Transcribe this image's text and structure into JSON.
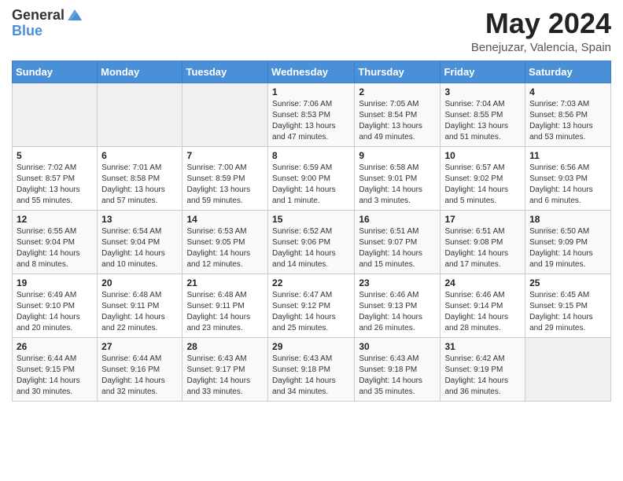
{
  "header": {
    "logo_general": "General",
    "logo_blue": "Blue",
    "title": "May 2024",
    "location": "Benejuzar, Valencia, Spain"
  },
  "days_of_week": [
    "Sunday",
    "Monday",
    "Tuesday",
    "Wednesday",
    "Thursday",
    "Friday",
    "Saturday"
  ],
  "weeks": [
    [
      {
        "day": "",
        "info": ""
      },
      {
        "day": "",
        "info": ""
      },
      {
        "day": "",
        "info": ""
      },
      {
        "day": "1",
        "info": "Sunrise: 7:06 AM\nSunset: 8:53 PM\nDaylight: 13 hours\nand 47 minutes."
      },
      {
        "day": "2",
        "info": "Sunrise: 7:05 AM\nSunset: 8:54 PM\nDaylight: 13 hours\nand 49 minutes."
      },
      {
        "day": "3",
        "info": "Sunrise: 7:04 AM\nSunset: 8:55 PM\nDaylight: 13 hours\nand 51 minutes."
      },
      {
        "day": "4",
        "info": "Sunrise: 7:03 AM\nSunset: 8:56 PM\nDaylight: 13 hours\nand 53 minutes."
      }
    ],
    [
      {
        "day": "5",
        "info": "Sunrise: 7:02 AM\nSunset: 8:57 PM\nDaylight: 13 hours\nand 55 minutes."
      },
      {
        "day": "6",
        "info": "Sunrise: 7:01 AM\nSunset: 8:58 PM\nDaylight: 13 hours\nand 57 minutes."
      },
      {
        "day": "7",
        "info": "Sunrise: 7:00 AM\nSunset: 8:59 PM\nDaylight: 13 hours\nand 59 minutes."
      },
      {
        "day": "8",
        "info": "Sunrise: 6:59 AM\nSunset: 9:00 PM\nDaylight: 14 hours\nand 1 minute."
      },
      {
        "day": "9",
        "info": "Sunrise: 6:58 AM\nSunset: 9:01 PM\nDaylight: 14 hours\nand 3 minutes."
      },
      {
        "day": "10",
        "info": "Sunrise: 6:57 AM\nSunset: 9:02 PM\nDaylight: 14 hours\nand 5 minutes."
      },
      {
        "day": "11",
        "info": "Sunrise: 6:56 AM\nSunset: 9:03 PM\nDaylight: 14 hours\nand 6 minutes."
      }
    ],
    [
      {
        "day": "12",
        "info": "Sunrise: 6:55 AM\nSunset: 9:04 PM\nDaylight: 14 hours\nand 8 minutes."
      },
      {
        "day": "13",
        "info": "Sunrise: 6:54 AM\nSunset: 9:04 PM\nDaylight: 14 hours\nand 10 minutes."
      },
      {
        "day": "14",
        "info": "Sunrise: 6:53 AM\nSunset: 9:05 PM\nDaylight: 14 hours\nand 12 minutes."
      },
      {
        "day": "15",
        "info": "Sunrise: 6:52 AM\nSunset: 9:06 PM\nDaylight: 14 hours\nand 14 minutes."
      },
      {
        "day": "16",
        "info": "Sunrise: 6:51 AM\nSunset: 9:07 PM\nDaylight: 14 hours\nand 15 minutes."
      },
      {
        "day": "17",
        "info": "Sunrise: 6:51 AM\nSunset: 9:08 PM\nDaylight: 14 hours\nand 17 minutes."
      },
      {
        "day": "18",
        "info": "Sunrise: 6:50 AM\nSunset: 9:09 PM\nDaylight: 14 hours\nand 19 minutes."
      }
    ],
    [
      {
        "day": "19",
        "info": "Sunrise: 6:49 AM\nSunset: 9:10 PM\nDaylight: 14 hours\nand 20 minutes."
      },
      {
        "day": "20",
        "info": "Sunrise: 6:48 AM\nSunset: 9:11 PM\nDaylight: 14 hours\nand 22 minutes."
      },
      {
        "day": "21",
        "info": "Sunrise: 6:48 AM\nSunset: 9:11 PM\nDaylight: 14 hours\nand 23 minutes."
      },
      {
        "day": "22",
        "info": "Sunrise: 6:47 AM\nSunset: 9:12 PM\nDaylight: 14 hours\nand 25 minutes."
      },
      {
        "day": "23",
        "info": "Sunrise: 6:46 AM\nSunset: 9:13 PM\nDaylight: 14 hours\nand 26 minutes."
      },
      {
        "day": "24",
        "info": "Sunrise: 6:46 AM\nSunset: 9:14 PM\nDaylight: 14 hours\nand 28 minutes."
      },
      {
        "day": "25",
        "info": "Sunrise: 6:45 AM\nSunset: 9:15 PM\nDaylight: 14 hours\nand 29 minutes."
      }
    ],
    [
      {
        "day": "26",
        "info": "Sunrise: 6:44 AM\nSunset: 9:15 PM\nDaylight: 14 hours\nand 30 minutes."
      },
      {
        "day": "27",
        "info": "Sunrise: 6:44 AM\nSunset: 9:16 PM\nDaylight: 14 hours\nand 32 minutes."
      },
      {
        "day": "28",
        "info": "Sunrise: 6:43 AM\nSunset: 9:17 PM\nDaylight: 14 hours\nand 33 minutes."
      },
      {
        "day": "29",
        "info": "Sunrise: 6:43 AM\nSunset: 9:18 PM\nDaylight: 14 hours\nand 34 minutes."
      },
      {
        "day": "30",
        "info": "Sunrise: 6:43 AM\nSunset: 9:18 PM\nDaylight: 14 hours\nand 35 minutes."
      },
      {
        "day": "31",
        "info": "Sunrise: 6:42 AM\nSunset: 9:19 PM\nDaylight: 14 hours\nand 36 minutes."
      },
      {
        "day": "",
        "info": ""
      }
    ]
  ]
}
